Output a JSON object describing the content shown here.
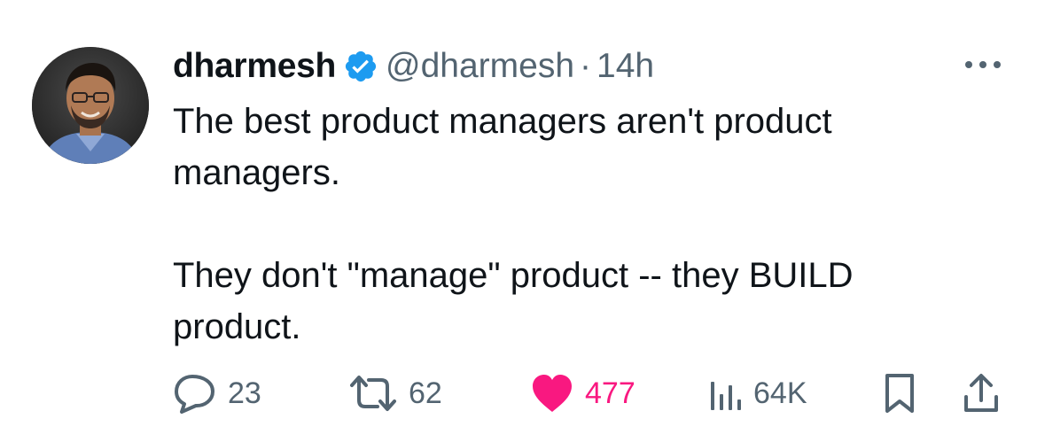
{
  "tweet": {
    "author": {
      "display_name": "dharmesh",
      "verified": true,
      "handle": "@dharmesh"
    },
    "separator": "·",
    "timestamp": "14h",
    "text": {
      "paragraph_1": "The best product managers aren't product managers.",
      "paragraph_2": "They don't \"manage\" product -- they BUILD product."
    },
    "actions": {
      "replies": "23",
      "reposts": "62",
      "likes": "477",
      "views": "64K"
    },
    "colors": {
      "text_primary": "#0f1419",
      "text_secondary": "#536471",
      "verified_blue": "#1d9bf0",
      "like_pink": "#f91880"
    },
    "icons": {
      "more": "more-horizontal-icon",
      "reply": "reply-bubble-icon",
      "repost": "repost-arrows-icon",
      "like": "heart-filled-icon",
      "views": "views-bars-icon",
      "bookmark": "bookmark-icon",
      "share": "share-upload-icon"
    }
  }
}
